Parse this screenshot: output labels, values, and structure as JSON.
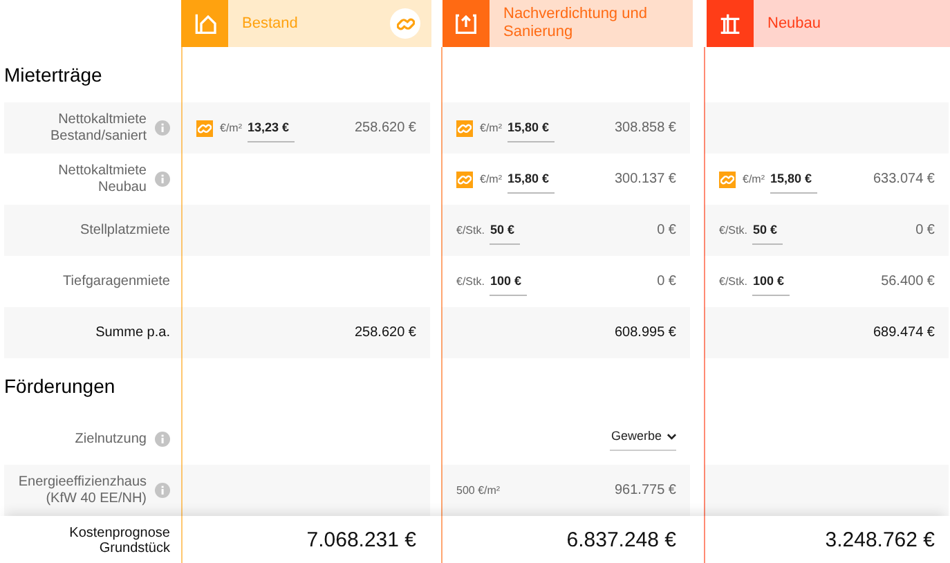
{
  "columns": [
    {
      "title": "Bestand",
      "color": "#ffa20f",
      "link_button": true
    },
    {
      "title": "Nachverdichtung und Sanierung",
      "color": "#ff6a13",
      "link_button": false
    },
    {
      "title": "Neubau",
      "color": "#ff3d17",
      "link_button": false
    }
  ],
  "sections": [
    {
      "title": "Mieterträge",
      "rows": [
        {
          "label": "Nettokaltmiete Bestand/saniert",
          "info": true,
          "kind": "input",
          "cells": [
            {
              "link": true,
              "unit": "€/m²",
              "value": "13,23 €",
              "amount": "258.620 €"
            },
            {
              "link": true,
              "unit": "€/m²",
              "value": "15,80 €",
              "amount": "308.858 €"
            },
            null
          ]
        },
        {
          "label": "Nettokaltmiete Neubau",
          "info": true,
          "kind": "input",
          "cells": [
            null,
            {
              "link": true,
              "unit": "€/m²",
              "value": "15,80 €",
              "amount": "300.137 €"
            },
            {
              "link": true,
              "unit": "€/m²",
              "value": "15,80 €",
              "amount": "633.074 €"
            }
          ]
        },
        {
          "label": "Stellplatzmiete",
          "info": false,
          "kind": "input",
          "cells": [
            null,
            {
              "link": false,
              "unit": "€/Stk.",
              "value": "50 €",
              "amount": "0 €"
            },
            {
              "link": false,
              "unit": "€/Stk.",
              "value": "50 €",
              "amount": "0 €"
            }
          ]
        },
        {
          "label": "Tiefgaragenmiete",
          "info": false,
          "kind": "input",
          "cells": [
            null,
            {
              "link": false,
              "unit": "€/Stk.",
              "value": "100 €",
              "amount": "0 €"
            },
            {
              "link": false,
              "unit": "€/Stk.",
              "value": "100 €",
              "amount": "56.400 €"
            }
          ]
        },
        {
          "label": "Summe p.a.",
          "info": false,
          "kind": "sum",
          "cells": [
            {
              "amount": "258.620 €"
            },
            {
              "amount": "608.995 €"
            },
            {
              "amount": "689.474 €"
            }
          ]
        }
      ]
    },
    {
      "title": "Förderungen",
      "rows": [
        {
          "label": "Zielnutzung",
          "info": true,
          "kind": "select",
          "cells": [
            null,
            {
              "value": "Gewerbe"
            },
            null
          ]
        },
        {
          "label": "Energieeffizienzhaus (KfW 40 EE/NH)",
          "info": true,
          "kind": "input",
          "cells": [
            null,
            {
              "link": false,
              "unit": "500 €/m²",
              "amount": "961.775 €"
            },
            null
          ]
        }
      ]
    }
  ],
  "total": {
    "label": "Kostenprognose Grundstück",
    "values": [
      "7.068.231 €",
      "6.837.248 €",
      "3.248.762 €"
    ]
  }
}
